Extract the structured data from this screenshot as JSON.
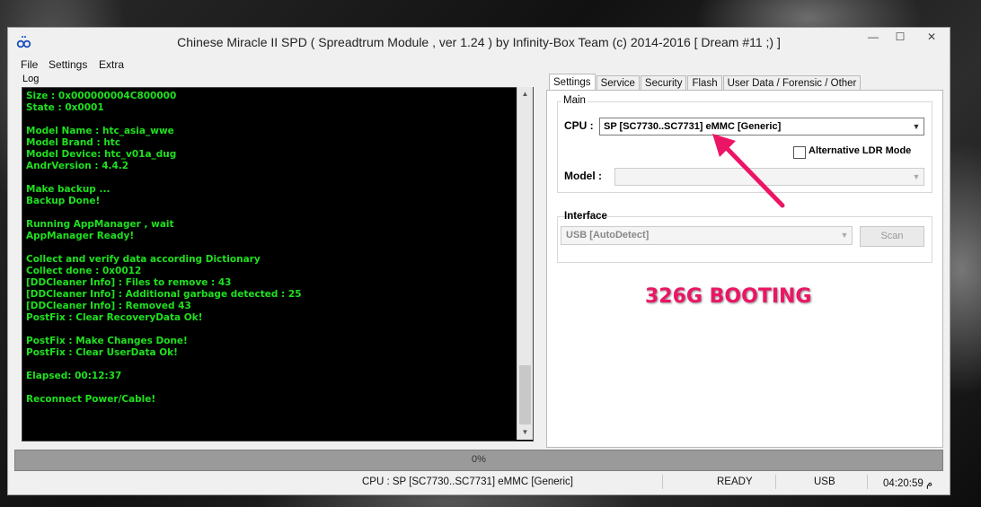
{
  "window": {
    "title": "Chinese Miracle II SPD ( Spreadtrum Module , ver 1.24 ) by Infinity-Box Team (c) 2014-2016 [ Dream #11 ;) ]",
    "controls": {
      "minimize": "—",
      "maximize": "☐",
      "close": "✕"
    }
  },
  "menu": {
    "items": [
      "File",
      "Settings",
      "Extra"
    ]
  },
  "log": {
    "label": "Log",
    "lines": [
      "Size : 0x000000004C800000",
      "State : 0x0001",
      "",
      "Model Name : htc_asia_wwe",
      "Model Brand : htc",
      "Model Device: htc_v01a_dug",
      "AndrVersion : 4.4.2",
      "",
      "Make backup ...",
      "Backup Done!",
      "",
      "Running AppManager , wait",
      "AppManager Ready!",
      "",
      "Collect and verify data according Dictionary",
      "Collect done : 0x0012",
      "[DDCleaner Info] : Files to remove : 43",
      "[DDCleaner Info] : Additional garbage detected : 25",
      "[DDCleaner Info] : Removed 43",
      "PostFix : Clear RecoveryData Ok!",
      "",
      "PostFix : Make Changes Done!",
      "PostFix : Clear UserData Ok!",
      "",
      "Elapsed: 00:12:37",
      "",
      "Reconnect Power/Cable!"
    ],
    "text_color": "#1fe01f"
  },
  "tabs": [
    "Settings",
    "Service",
    "Security",
    "Flash",
    "User Data / Forensic / Other"
  ],
  "settings": {
    "main_group": "Main",
    "cpu_label": "CPU :",
    "cpu_value": "SP [SC7730..SC7731] eMMC [Generic]",
    "alt_ldr_label": "Alternative LDR Mode",
    "alt_ldr_checked": false,
    "model_label": "Model :",
    "model_value": "",
    "interface_group": "Interface",
    "interface_value": "USB [AutoDetect]",
    "scan_label": "Scan"
  },
  "annotation": {
    "text": "326G BOOTING",
    "color": "#ec1565"
  },
  "progress": {
    "text": "0%",
    "value": 0
  },
  "status": {
    "cpu": "CPU : SP [SC7730..SC7731] eMMC [Generic]",
    "state": "READY",
    "port": "USB",
    "time": "04:20:59 م"
  }
}
